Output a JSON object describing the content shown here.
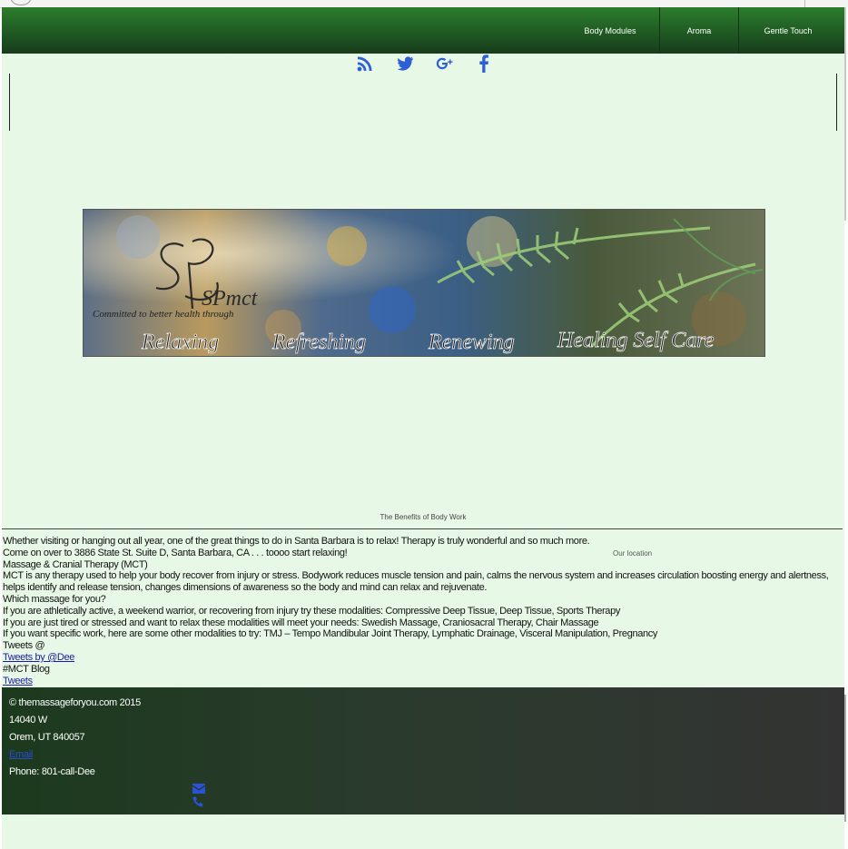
{
  "nav": {
    "items": [
      {
        "label": "Body Modules"
      },
      {
        "label": "Aroma"
      },
      {
        "label": "Gentle Touch"
      }
    ]
  },
  "social": {
    "icons": [
      "rss-icon",
      "twitter-icon",
      "google-plus-icon",
      "facebook-icon"
    ],
    "icon_color": "#2d5fd6"
  },
  "banner": {
    "logo_text": "SPmct",
    "tagline": "Committed to better health through",
    "words": [
      "Relaxing",
      "Refreshing",
      "Renewing",
      "Healing Self Care"
    ]
  },
  "section": {
    "title": "The Benefits of Body Work",
    "location_label": "Our location"
  },
  "content": {
    "p1": "Whether visiting or hanging out all year, one of the great things to do in Santa Barbara is to relax! Therapy is truly wonderful and so much more.",
    "p2": "Come on over to 3886 State St. Suite D, Santa Barbara, CA . . . toooo start relaxing!",
    "heading": "Massage & Cranial Therapy (MCT)",
    "p3": "MCT is any therapy used to help your body recover from injury or stress. Bodywork reduces muscle tension and pain, calms the nervous system and increases circulation boosting energy and alertness, helps identify and release tension, changes dimensions of awareness so the body and mind can relax and rejuvenate.",
    "q": "Which massage for you?",
    "l1": "If you are athletically active, a weekend warrior, or recovering from injury try these modalities: Compressive Deep Tissue, Deep Tissue, Sports Therapy",
    "l2": "If you are just tired or stressed and want to relax these modalities will meet your needs: Swedish Massage, Craniosacral Therapy, Chair Massage",
    "l3": "If you want specific work, here are some other modalities to try: TMJ – Tempo Mandibular Joint Therapy, Lymphatic Drainage, Visceral Manipulation, Pregnancy",
    "tweets_at": "Tweets @",
    "tweets_link": "Tweets by @Dee",
    "blog": "#MCT Blog",
    "tweets": "Tweets"
  },
  "footer": {
    "copyright": "© themassageforyou.com 2015",
    "address1": "14040 W",
    "address2": "Orem, UT 840057",
    "email": "Email",
    "phone": "Phone: 801-call-Dee"
  },
  "colors": {
    "page_bg": "#e8f8e6",
    "nav_green": "#1f5a22",
    "footer_dark": "#2a3b2c",
    "link_blue": "#1a1aa6"
  }
}
